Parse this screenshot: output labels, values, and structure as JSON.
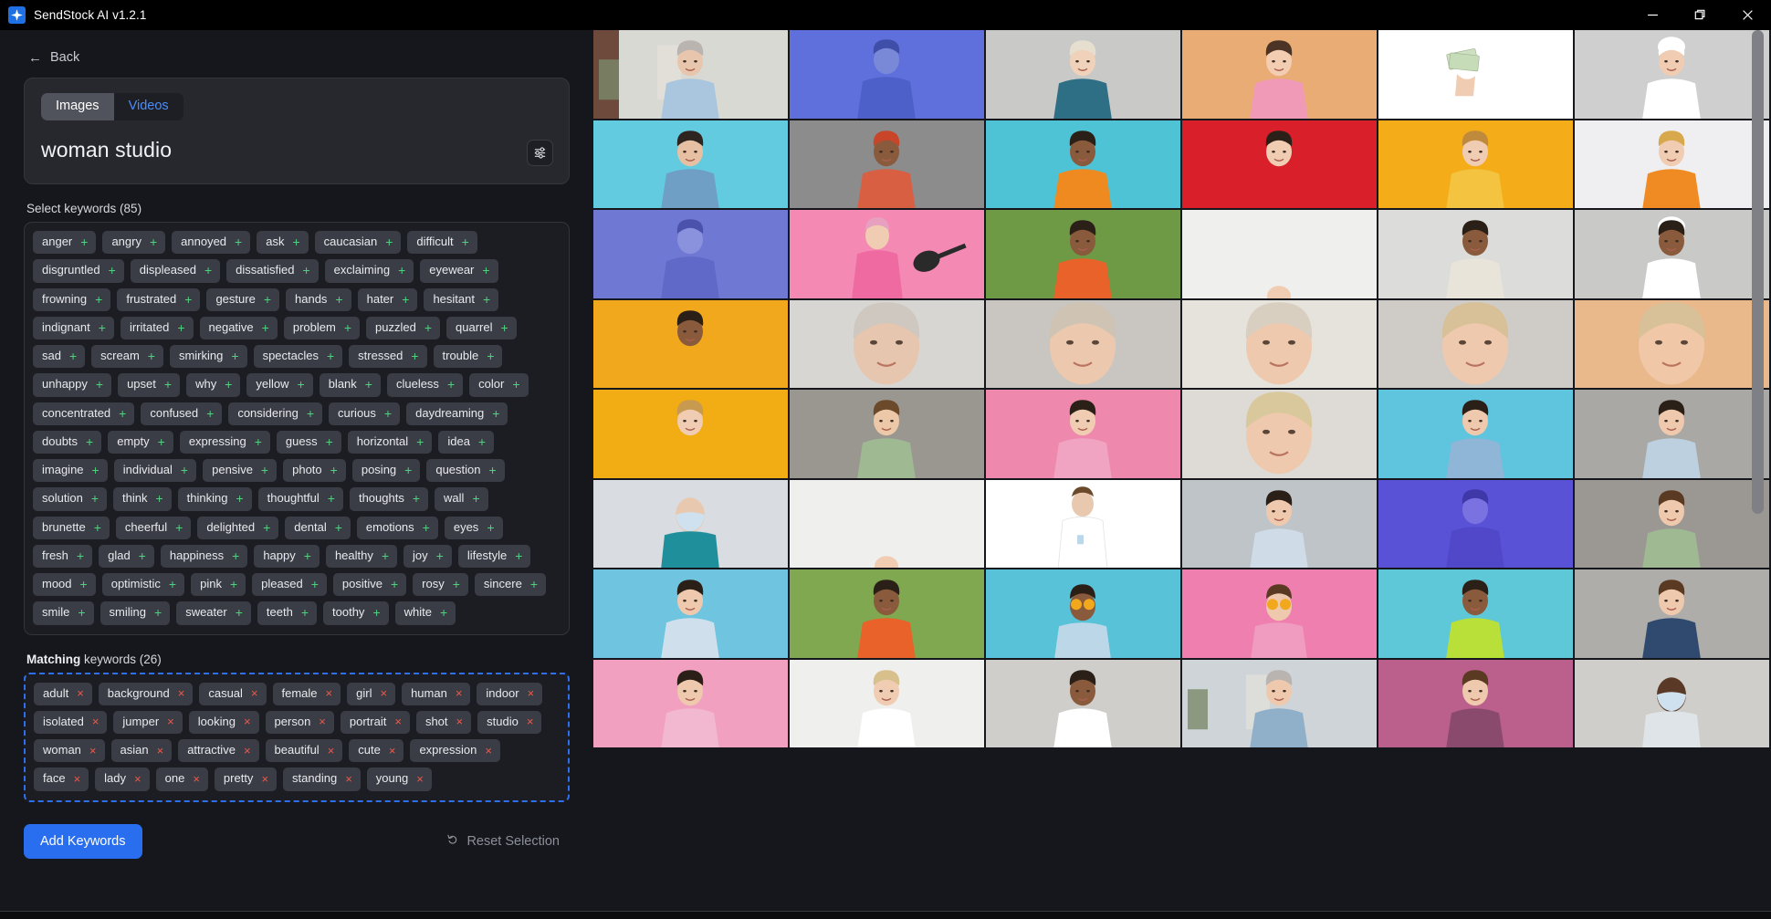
{
  "window": {
    "title": "SendStock AI v1.2.1",
    "logo_icon": "sparkle-icon",
    "minimize_label": "—",
    "maximize_label": "❐",
    "close_label": "✕"
  },
  "nav": {
    "back_label": "Back",
    "back_icon": "arrow-left-icon"
  },
  "search": {
    "tabs": [
      {
        "label": "Images",
        "active": true
      },
      {
        "label": "Videos",
        "active": false
      }
    ],
    "query": "woman studio",
    "filter_icon": "sliders-icon"
  },
  "select_keywords": {
    "label_prefix": "Select",
    "label_rest": " keywords (85)",
    "count": 85,
    "add_glyph": "+",
    "items": [
      "anger",
      "angry",
      "annoyed",
      "ask",
      "caucasian",
      "difficult",
      "disgruntled",
      "displeased",
      "dissatisfied",
      "exclaiming",
      "eyewear",
      "frowning",
      "frustrated",
      "gesture",
      "hands",
      "hater",
      "hesitant",
      "indignant",
      "irritated",
      "negative",
      "problem",
      "puzzled",
      "quarrel",
      "sad",
      "scream",
      "smirking",
      "spectacles",
      "stressed",
      "trouble",
      "unhappy",
      "upset",
      "why",
      "yellow",
      "blank",
      "clueless",
      "color",
      "concentrated",
      "confused",
      "considering",
      "curious",
      "daydreaming",
      "doubts",
      "empty",
      "expressing",
      "guess",
      "horizontal",
      "idea",
      "imagine",
      "individual",
      "pensive",
      "photo",
      "posing",
      "question",
      "solution",
      "think",
      "thinking",
      "thoughtful",
      "thoughts",
      "wall",
      "brunette",
      "cheerful",
      "delighted",
      "dental",
      "emotions",
      "eyes",
      "fresh",
      "glad",
      "happiness",
      "happy",
      "healthy",
      "joy",
      "lifestyle",
      "mood",
      "optimistic",
      "pink",
      "pleased",
      "positive",
      "rosy",
      "sincere",
      "smile",
      "smiling",
      "sweater",
      "teeth",
      "toothy",
      "white"
    ]
  },
  "matching_keywords": {
    "label_prefix": "Matching",
    "label_rest": " keywords (26)",
    "count": 26,
    "remove_glyph": "×",
    "items": [
      "adult",
      "background",
      "casual",
      "female",
      "girl",
      "human",
      "indoor",
      "isolated",
      "jumper",
      "looking",
      "person",
      "portrait",
      "shot",
      "studio",
      "woman",
      "asian",
      "attractive",
      "beautiful",
      "cute",
      "expression",
      "face",
      "lady",
      "one",
      "pretty",
      "standing",
      "young"
    ]
  },
  "actions": {
    "add_keywords_label": "Add Keywords",
    "reset_label": "Reset Selection",
    "reset_icon": "undo-icon"
  },
  "colors": {
    "accent": "#2a6ef0",
    "tab_link": "#4c8dfb",
    "add_plus": "#4fd17e",
    "remove_cross": "#f0574a",
    "matching_border": "#2f6fed",
    "panel_bg": "#16171c",
    "card_bg": "#26282e",
    "tag_bg": "#3a3d45",
    "titlebar_bg": "#000000"
  },
  "results_grid": {
    "columns": 6,
    "cells": [
      {
        "bg": "#d9d9d4",
        "sub": "#6e4a3c",
        "kind": "studio-interior",
        "skin": "#e8c6ad",
        "hair": "#b9b4b0",
        "cloth": "#aac6de"
      },
      {
        "bg": "#5f6fdb",
        "sub": "#5f6fdb",
        "kind": "duotone",
        "skin": "#7a88d8",
        "hair": "#3f4ea8",
        "cloth": "#4d5fc9"
      },
      {
        "bg": "#c9c9c7",
        "sub": "#c9c9c7",
        "kind": "portrait",
        "skin": "#f0d2bb",
        "hair": "#e6dfcf",
        "cloth": "#2f6f86"
      },
      {
        "bg": "#e9ac75",
        "sub": "#e9ac75",
        "kind": "portrait",
        "skin": "#f3cdb2",
        "hair": "#4b3326",
        "cloth": "#f09ab8"
      },
      {
        "bg": "#ffffff",
        "sub": "#ffffff",
        "kind": "money",
        "skin": "#f0cdb2",
        "hair": "#8fbf7f",
        "cloth": "#8fbf7f"
      },
      {
        "bg": "#cfcfcf",
        "sub": "#cfcfcf",
        "kind": "chef",
        "skin": "#f0cdb2",
        "hair": "#ffffff",
        "cloth": "#ffffff"
      },
      {
        "bg": "#63cbe0",
        "sub": "#63cbe0",
        "kind": "portrait",
        "skin": "#e7c0a4",
        "hair": "#2f2520",
        "cloth": "#6f9fc4"
      },
      {
        "bg": "#8c8c8c",
        "sub": "#8c8c8c",
        "kind": "portrait",
        "skin": "#8a5a3c",
        "hair": "#c8452a",
        "cloth": "#d95f42"
      },
      {
        "bg": "#4ec3d6",
        "sub": "#4ec3d6",
        "kind": "portrait",
        "skin": "#8a5a3c",
        "hair": "#2b2018",
        "cloth": "#ef8a21"
      },
      {
        "bg": "#d81f2a",
        "sub": "#d81f2a",
        "kind": "portrait",
        "skin": "#f0cdb2",
        "hair": "#2b2018",
        "cloth": "#d81f2a"
      },
      {
        "bg": "#f4ad19",
        "sub": "#f4ad19",
        "kind": "portrait",
        "skin": "#f0cdb2",
        "hair": "#c08a3c",
        "cloth": "#f4c33f"
      },
      {
        "bg": "#efeff1",
        "sub": "#efeff1",
        "kind": "portrait",
        "skin": "#f0cdb2",
        "hair": "#d8a84c",
        "cloth": "#f08a22"
      },
      {
        "bg": "#6f78d3",
        "sub": "#6f78d3",
        "kind": "duotone",
        "skin": "#8a92de",
        "hair": "#4a52ac",
        "cloth": "#6068c8"
      },
      {
        "bg": "#f48ab4",
        "sub": "#f48ab4",
        "kind": "guitar",
        "skin": "#f0cdb2",
        "hair": "#e8a0c0",
        "cloth": "#ef6aa0"
      },
      {
        "bg": "#6f9a45",
        "sub": "#6f9a45",
        "kind": "portrait",
        "skin": "#8a5a3c",
        "hair": "#2b2018",
        "cloth": "#e8622a"
      },
      {
        "bg": "#efefee",
        "sub": "#efefee",
        "kind": "blank",
        "skin": "#f0cdb2",
        "hair": "#d8c8b8",
        "cloth": "#efefee"
      },
      {
        "bg": "#dcdcda",
        "sub": "#dcdcda",
        "kind": "portrait",
        "skin": "#8a5a3c",
        "hair": "#2b2018",
        "cloth": "#e8e4da"
      },
      {
        "bg": "#c9c9c7",
        "sub": "#c9c9c7",
        "kind": "chef",
        "skin": "#8a5a3c",
        "hair": "#2b2018",
        "cloth": "#ffffff"
      },
      {
        "bg": "#f2a81c",
        "sub": "#f2a81c",
        "kind": "portrait",
        "skin": "#8a5a3c",
        "hair": "#2b2018",
        "cloth": "#f2a81c"
      },
      {
        "bg": "#d8d6d2",
        "sub": "#d8d6d2",
        "kind": "closeup",
        "skin": "#e6c6ae",
        "hair": "#cfc8c0",
        "cloth": "#d8d6d2"
      },
      {
        "bg": "#c9c5c0",
        "sub": "#c9c5c0",
        "kind": "closeup",
        "skin": "#ecc9ae",
        "hair": "#cfc4b4",
        "cloth": "#c9c5c0"
      },
      {
        "bg": "#e6e2dc",
        "sub": "#e6e2dc",
        "kind": "closeup",
        "skin": "#eec9ad",
        "hair": "#d8cfc0",
        "cloth": "#e6e2dc"
      },
      {
        "bg": "#cfccc7",
        "sub": "#cfccc7",
        "kind": "closeup",
        "skin": "#eec9ad",
        "hair": "#d8c098",
        "cloth": "#cfccc7"
      },
      {
        "bg": "#e9b98c",
        "sub": "#e9b98c",
        "kind": "closeup",
        "skin": "#f0c8a8",
        "hair": "#d8c098",
        "cloth": "#e9b98c"
      },
      {
        "bg": "#f2ac14",
        "sub": "#f2ac14",
        "kind": "portrait",
        "skin": "#f0cdb2",
        "hair": "#c89a50",
        "cloth": "#f2ac14"
      },
      {
        "bg": "#9a9791",
        "sub": "#9a9791",
        "kind": "portrait",
        "skin": "#edc8a8",
        "hair": "#6b4a2c",
        "cloth": "#9fba93"
      },
      {
        "bg": "#ef88ad",
        "sub": "#ef88ad",
        "kind": "portrait",
        "skin": "#f0cdb2",
        "hair": "#2b2018",
        "cloth": "#f0a4c2"
      },
      {
        "bg": "#dedbd6",
        "sub": "#dedbd6",
        "kind": "closeup",
        "skin": "#eec9ad",
        "hair": "#d8c89c",
        "cloth": "#dedbd6"
      },
      {
        "bg": "#5fc4dd",
        "sub": "#5fc4dd",
        "kind": "portrait",
        "skin": "#eec9ad",
        "hair": "#2b2018",
        "cloth": "#8fb6d6"
      },
      {
        "bg": "#a9a8a5",
        "sub": "#a9a8a5",
        "kind": "portrait",
        "skin": "#eec9ad",
        "hair": "#2b2018",
        "cloth": "#bcd0e0"
      },
      {
        "bg": "#d9dce0",
        "sub": "#d9dce0",
        "kind": "mask",
        "skin": "#e8c8ae",
        "hair": "#2b2018",
        "cloth": "#1f8f9c"
      },
      {
        "bg": "#efefee",
        "sub": "#efefee",
        "kind": "blank",
        "skin": "#f0cdb2",
        "hair": "#cfa86c",
        "cloth": "#efefee"
      },
      {
        "bg": "#ffffff",
        "sub": "#ffffff",
        "kind": "lab",
        "skin": "#e8c8ae",
        "hair": "#6b4a2c",
        "cloth": "#ffffff"
      },
      {
        "bg": "#bfc4c9",
        "sub": "#bfc4c9",
        "kind": "portrait",
        "skin": "#eec9ad",
        "hair": "#2b2018",
        "cloth": "#cfdce8"
      },
      {
        "bg": "#5a52d6",
        "sub": "#5a52d6",
        "kind": "duotone",
        "skin": "#7a72e0",
        "hair": "#3f38a8",
        "cloth": "#5048c8"
      },
      {
        "bg": "#9b9894",
        "sub": "#9b9894",
        "kind": "portrait",
        "skin": "#eec9ad",
        "hair": "#5a3a22",
        "cloth": "#9fba93"
      },
      {
        "bg": "#6fc5e0",
        "sub": "#6fc5e0",
        "kind": "portrait",
        "skin": "#eec9ad",
        "hair": "#2b2018",
        "cloth": "#cfe0ec"
      },
      {
        "bg": "#7fa850",
        "sub": "#7fa850",
        "kind": "portrait",
        "skin": "#8a5a3c",
        "hair": "#2b2018",
        "cloth": "#e8622a"
      },
      {
        "bg": "#57c2d8",
        "sub": "#57c2d8",
        "kind": "flowers",
        "skin": "#8a5a3c",
        "hair": "#2b2018",
        "cloth": "#bcd8e8"
      },
      {
        "bg": "#ef7fae",
        "sub": "#ef7fae",
        "kind": "flowers",
        "skin": "#eec9ad",
        "hair": "#5a3a22",
        "cloth": "#ef9cc0"
      },
      {
        "bg": "#5ec8d8",
        "sub": "#5ec8d8",
        "kind": "portrait",
        "skin": "#8a5a3c",
        "hair": "#2b2018",
        "cloth": "#b8e038"
      },
      {
        "bg": "#aeadaa",
        "sub": "#aeadaa",
        "kind": "portrait",
        "skin": "#eec9ad",
        "hair": "#5a3a22",
        "cloth": "#2f4a6e"
      },
      {
        "bg": "#f2a0c0",
        "sub": "#f2a0c0",
        "kind": "portrait",
        "skin": "#eec9ad",
        "hair": "#2b2018",
        "cloth": "#f2b8d0"
      },
      {
        "bg": "#efefee",
        "sub": "#efefee",
        "kind": "portrait",
        "skin": "#f0cdb2",
        "hair": "#d8c08c",
        "cloth": "#ffffff"
      },
      {
        "bg": "#cfcecb",
        "sub": "#cfcecb",
        "kind": "portrait",
        "skin": "#8a5a3c",
        "hair": "#2b2018",
        "cloth": "#ffffff"
      },
      {
        "bg": "#cfd4d8",
        "sub": "#cfd4d8",
        "kind": "studio-interior",
        "skin": "#eec9ad",
        "hair": "#b9b4b0",
        "cloth": "#8fb0c8"
      },
      {
        "bg": "#bb5f8c",
        "sub": "#bb5f8c",
        "kind": "portrait",
        "skin": "#eec9ad",
        "hair": "#5a3a22",
        "cloth": "#8a4a6e"
      },
      {
        "bg": "#cfcecb",
        "sub": "#cfcecb",
        "kind": "mask",
        "skin": "#5a3a26",
        "hair": "#2b2018",
        "cloth": "#dfe4e8"
      }
    ]
  }
}
